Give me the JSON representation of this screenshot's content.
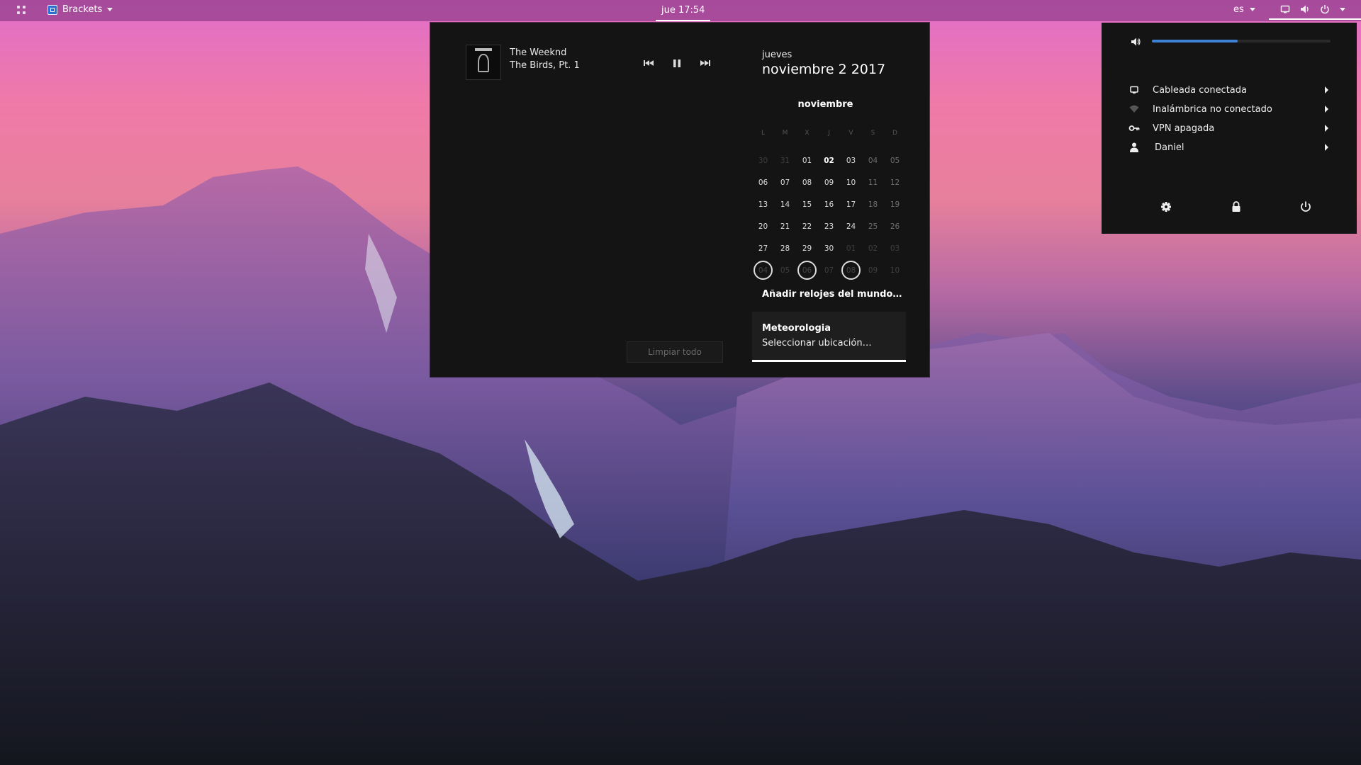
{
  "topbar": {
    "app_name": "Brackets",
    "clock": "jue 17:54",
    "language": "es"
  },
  "media": {
    "artist": "The Weeknd",
    "track": "The Birds, Pt. 1"
  },
  "notifications": {
    "clear_label": "Limpiar todo"
  },
  "date": {
    "dayname": "jueves",
    "full": "noviembre  2 2017"
  },
  "calendar": {
    "month": "noviembre",
    "weekdays": [
      "L",
      "M",
      "X",
      "J",
      "V",
      "S",
      "D"
    ],
    "weeks": [
      [
        "30",
        "31",
        "01",
        "02",
        "03",
        "04",
        "05"
      ],
      [
        "06",
        "07",
        "08",
        "09",
        "10",
        "11",
        "12"
      ],
      [
        "13",
        "14",
        "15",
        "16",
        "17",
        "18",
        "19"
      ],
      [
        "20",
        "21",
        "22",
        "23",
        "24",
        "25",
        "26"
      ],
      [
        "27",
        "28",
        "29",
        "30",
        "01",
        "02",
        "03"
      ],
      [
        "04",
        "05",
        "06",
        "07",
        "08",
        "09",
        "10"
      ]
    ]
  },
  "world_clocks_label": "Añadir relojes del mundo…",
  "weather": {
    "title": "Meteorologia",
    "subtitle": "Seleccionar ubicación…"
  },
  "system_menu": {
    "volume_percent": 48,
    "items": [
      {
        "label": "Cableada conectada",
        "icon": "wired-network-icon"
      },
      {
        "label": "Inalámbrica no conectado",
        "icon": "wireless-icon"
      },
      {
        "label": "VPN apagada",
        "icon": "vpn-key-icon"
      },
      {
        "label": "Daniel",
        "icon": "user-icon"
      }
    ],
    "buttons": [
      "settings-icon",
      "lock-icon",
      "power-icon"
    ]
  },
  "colors": {
    "accent": "#3c81d6",
    "panel_bg": "#141414"
  }
}
